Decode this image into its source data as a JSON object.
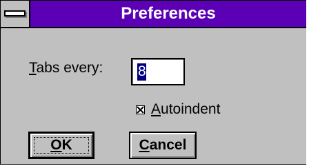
{
  "window": {
    "title": "Preferences"
  },
  "tabs": {
    "label_mnemonic": "T",
    "label_rest": "abs every:",
    "value": "8"
  },
  "autoindent": {
    "label_mnemonic": "A",
    "label_rest": "utoindent",
    "checked": true
  },
  "buttons": {
    "ok_mnemonic": "O",
    "ok_rest": "K",
    "cancel_mnemonic": "C",
    "cancel_rest": "ancel"
  },
  "colors": {
    "titlebar": "#5b00b5",
    "face": "#c0c0c0",
    "selection": "#000080"
  },
  "icons": {
    "system_menu": "system-menu-icon",
    "checkbox_mark": "x-mark-icon"
  }
}
